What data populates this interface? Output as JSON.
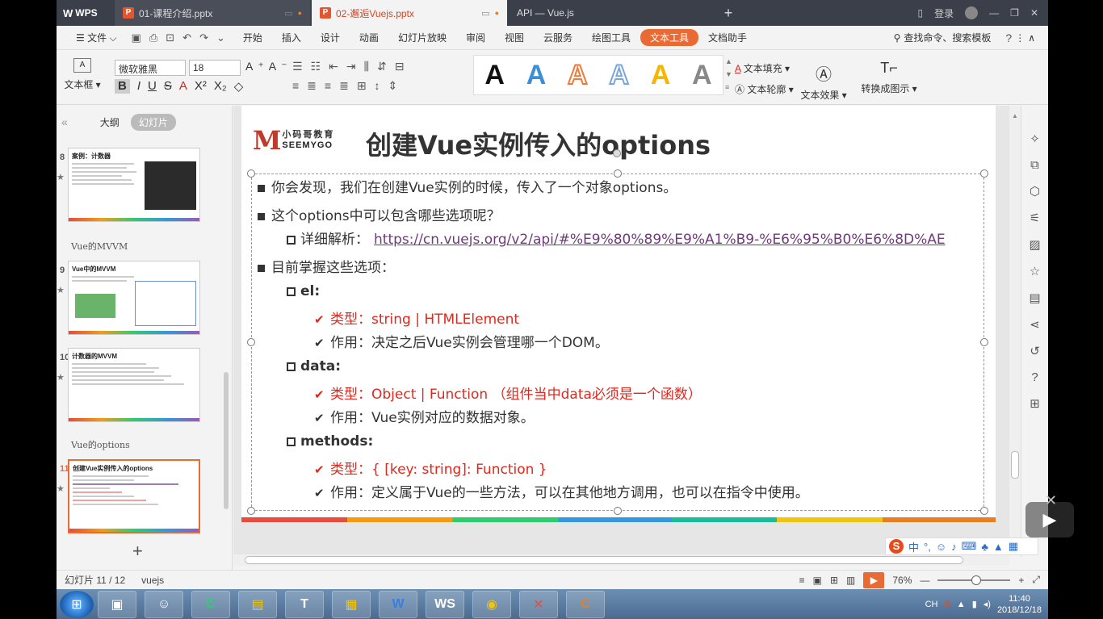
{
  "titlebar": {
    "app": "WPS",
    "tabs": [
      {
        "label": "01-课程介绍.pptx"
      },
      {
        "label": "02-邂逅Vuejs.pptx"
      },
      {
        "label": "API — Vue.js"
      }
    ],
    "login": "登录"
  },
  "menu": {
    "file": "文件",
    "items": [
      "开始",
      "插入",
      "设计",
      "动画",
      "幻灯片放映",
      "审阅",
      "视图",
      "云服务",
      "绘图工具"
    ],
    "active": "文本工具",
    "assistant": "文档助手",
    "search": "查找命令、搜索模板"
  },
  "ribbon": {
    "textbox": "文本框",
    "font": "微软雅黑",
    "size": "18",
    "wordart_letter": "A",
    "text_fill": "文本填充",
    "text_outline": "文本轮廓",
    "text_effect": "文本效果",
    "convert": "转换成图示"
  },
  "leftpanel": {
    "tab_outline": "大纲",
    "tab_slides": "幻灯片",
    "slides": [
      {
        "num": "8",
        "title": "案例：计数器"
      },
      {
        "num": "9",
        "title": "Vue中的MVVM"
      },
      {
        "num": "10",
        "title": "计数器的MVVM"
      },
      {
        "num": "11",
        "title": "创建Vue实例传入的options"
      }
    ],
    "sections": [
      "Vue的MVVM",
      "Vue的options"
    ]
  },
  "slide": {
    "logo_cn": "小码哥教育",
    "logo_en": "SEEMYGO",
    "title": "创建Vue实例传入的options",
    "lines": {
      "p1": "你会发现，我们在创建Vue实例的时候，传入了一个对象options。",
      "p2": "这个options中可以包含哪些选项呢？",
      "p2_detail": "详细解析：",
      "p2_link": "https://cn.vuejs.org/v2/api/#%E9%80%89%E9%A1%B9-%E6%95%B0%E6%8D%AE",
      "p3": "目前掌握这些选项：",
      "el": "el:",
      "el_type": "类型：string | HTMLElement",
      "el_use": "作用：决定之后Vue实例会管理哪一个DOM。",
      "data": "data:",
      "data_type": "类型：Object | Function （组件当中data必须是一个函数）",
      "data_use": "作用：Vue实例对应的数据对象。",
      "methods": "methods:",
      "methods_type": "类型：{ [key: string]: Function }",
      "methods_use": "作用：定义属于Vue的一些方法，可以在其他地方调用，也可以在指令中使用。"
    }
  },
  "statusbar": {
    "slide_info": "幻灯片 11 / 12",
    "theme": "vuejs",
    "zoom": "76%",
    "zoom_fraction": 0.5
  },
  "ime": {
    "lang": "中"
  },
  "tray": {
    "lang": "CH",
    "time": "11:40",
    "date": "2018/12/18"
  },
  "colors": {
    "accent": "#e86b35",
    "red": "#e0281e",
    "link": "#6e3a7a"
  }
}
